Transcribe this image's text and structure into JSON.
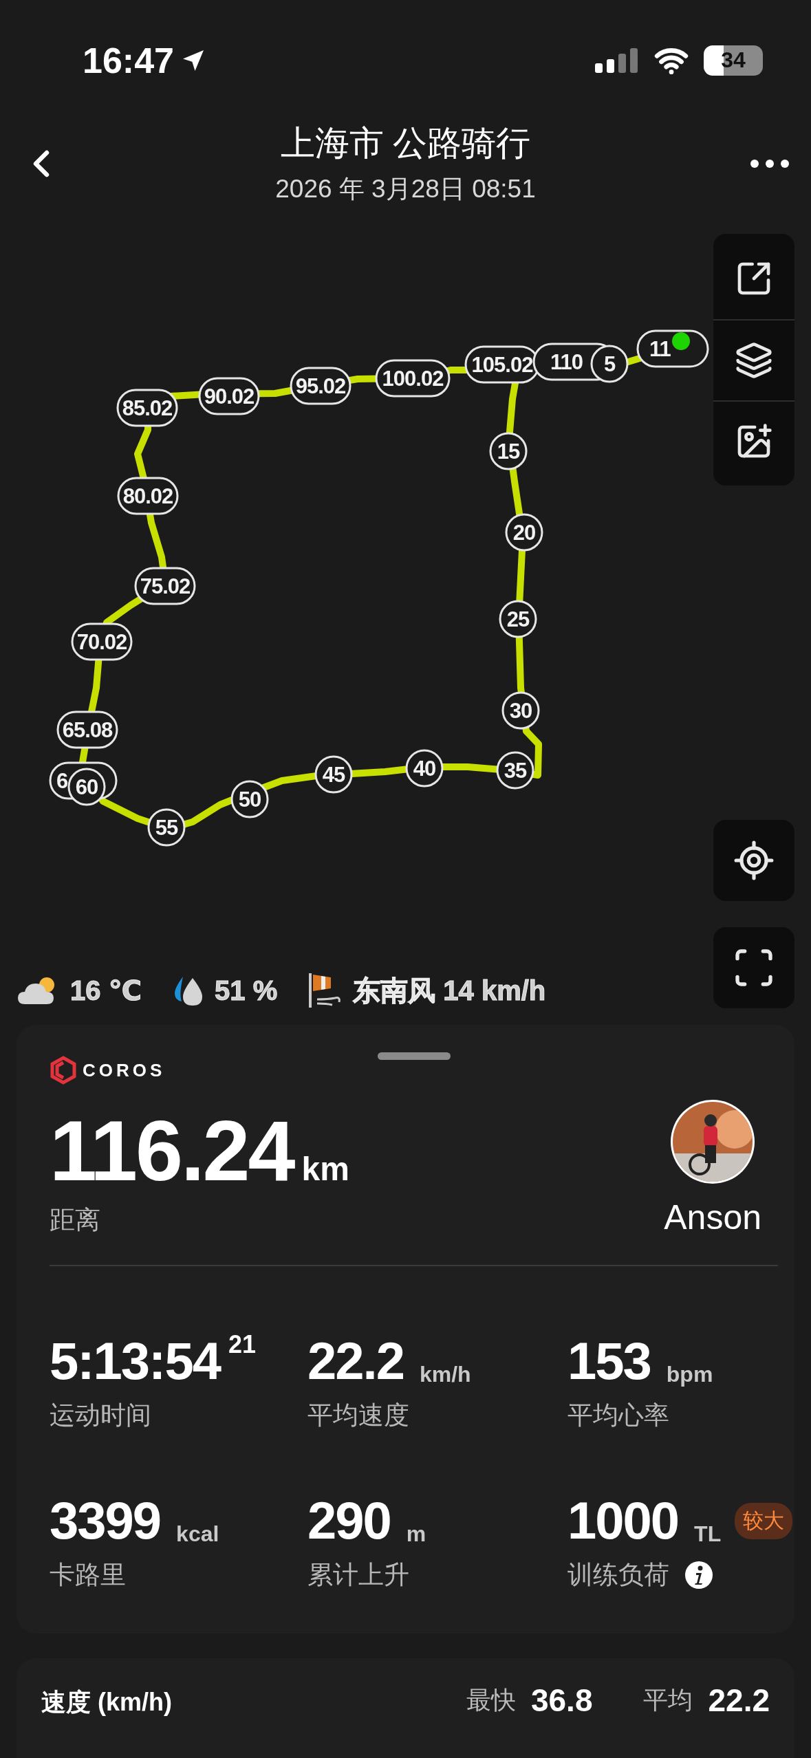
{
  "status_bar": {
    "time": "16:47",
    "battery": "34"
  },
  "header": {
    "title": "上海市 公路骑行",
    "subtitle": "2026 年 3月28日 08:51"
  },
  "map": {
    "markers": [
      {
        "label": "85.02"
      },
      {
        "label": "90.02"
      },
      {
        "label": "95.02"
      },
      {
        "label": "100.02"
      },
      {
        "label": "105.02"
      },
      {
        "label": "110"
      },
      {
        "label": "5"
      },
      {
        "label": "11"
      },
      {
        "label": "15"
      },
      {
        "label": "80.02"
      },
      {
        "label": "20"
      },
      {
        "label": "75.02"
      },
      {
        "label": "70.02"
      },
      {
        "label": "25"
      },
      {
        "label": "65.08"
      },
      {
        "label": "30"
      },
      {
        "label": "6"
      },
      {
        "label": "60"
      },
      {
        "label": "55"
      },
      {
        "label": "50"
      },
      {
        "label": "45"
      },
      {
        "label": "40"
      },
      {
        "label": "35"
      }
    ]
  },
  "weather": [
    {
      "kind": "temperature",
      "text": "16 ℃"
    },
    {
      "kind": "humidity",
      "text": "51 %"
    },
    {
      "kind": "wind",
      "text": "东南风 14 km/h"
    }
  ],
  "summary": {
    "brand": "COROS",
    "distance": {
      "value": "116.24",
      "unit": "km",
      "label": "距离"
    },
    "user": {
      "name": "Anson"
    },
    "stats": [
      {
        "value": "5:13:54$^{21}$",
        "label": "运动时间"
      },
      {
        "value": "22.2",
        "unit": "km/h",
        "label": "平均速度"
      },
      {
        "value": "153",
        "unit": "bpm",
        "label": "平均心率"
      },
      {
        "value": "3399",
        "unit": "kcal",
        "label": "卡路里"
      },
      {
        "value": "290",
        "unit": "m",
        "label": "累计上升"
      },
      {
        "value": "1000",
        "unit": "TL",
        "badge": "较大",
        "label": "训练负荷",
        "info": true
      }
    ]
  },
  "speed_chart": {
    "title": "速度 (km/h)",
    "max_label": "最快",
    "max": "36.8",
    "avg_label": "平均",
    "avg": "22.2"
  }
}
